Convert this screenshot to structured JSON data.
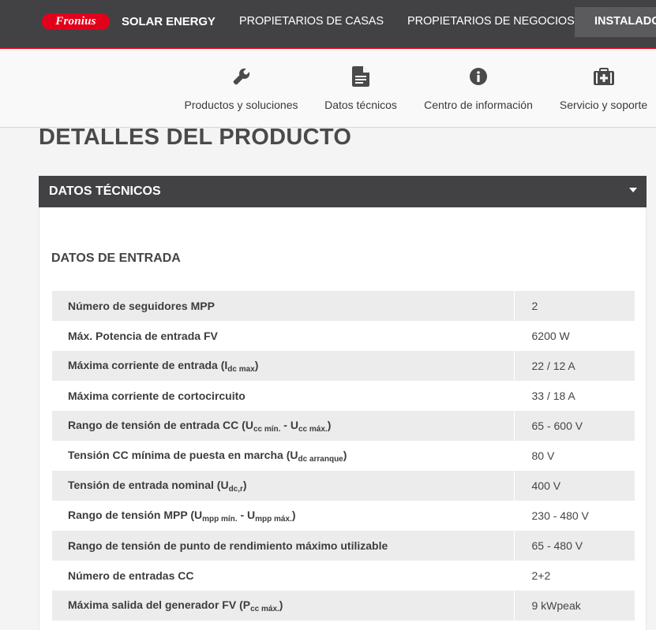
{
  "header": {
    "logo_text": "Fronius",
    "brand": "SOLAR ENERGY",
    "nav": [
      "PROPIETARIOS DE CASAS",
      "PROPIETARIOS DE NEGOCIOS",
      "INSTALADORES"
    ]
  },
  "subnav": {
    "items": [
      {
        "label": "Productos y soluciones",
        "icon": "wrench-icon"
      },
      {
        "label": "Datos técnicos",
        "icon": "document-icon"
      },
      {
        "label": "Centro de información",
        "icon": "info-icon"
      },
      {
        "label": "Servicio y soporte",
        "icon": "first-aid-kit-icon"
      }
    ]
  },
  "page": {
    "title": "DETALLES DEL PRODUCTO",
    "accordion_title": "DATOS TÉCNICOS",
    "section_title": "DATOS DE ENTRADA"
  },
  "specs": [
    {
      "label": "Número de seguidores MPP",
      "value": "2"
    },
    {
      "label": "Máx. Potencia de entrada FV",
      "value": "6200 W"
    },
    {
      "label": "Máxima corriente de entrada (",
      "sub1": "dc max",
      "mid": ")",
      "value": "22 / 12 A",
      "sym1": "I"
    },
    {
      "label": "Máxima corriente de cortocircuito",
      "value": "33 / 18 A"
    },
    {
      "label": "Rango de tensión de entrada CC (",
      "sym1": "U",
      "sub1": "cc mín.",
      "mid": " - ",
      "sym2": "U",
      "sub2": "cc máx.",
      "end": ")",
      "value": "65 - 600 V"
    },
    {
      "label": "Tensión CC mínima de puesta en marcha (",
      "sym1": "U",
      "sub1": "dc arranque",
      "end": ")",
      "value": "80 V"
    },
    {
      "label": "Tensión de entrada nominal (",
      "sym1": "U",
      "sub1": "dc,r",
      "end": ")",
      "value": "400 V"
    },
    {
      "label": "Rango de tensión MPP (",
      "sym1": "U",
      "sub1": "mpp mín.",
      "mid": " - ",
      "sym2": "U",
      "sub2": "mpp máx.",
      "end": ")",
      "value": "230 - 480 V"
    },
    {
      "label": "Rango de tensión de punto de rendimiento máximo utilizable",
      "value": "65 - 480 V"
    },
    {
      "label": "Número de entradas CC",
      "value": "2+2"
    },
    {
      "label": "Máxima salida del generador FV (",
      "sym1": "P",
      "sub1": "cc máx.",
      "end": ")",
      "value": "9 kWpeak"
    }
  ],
  "colors": {
    "accent": "#e2001a",
    "dark": "#424244"
  }
}
